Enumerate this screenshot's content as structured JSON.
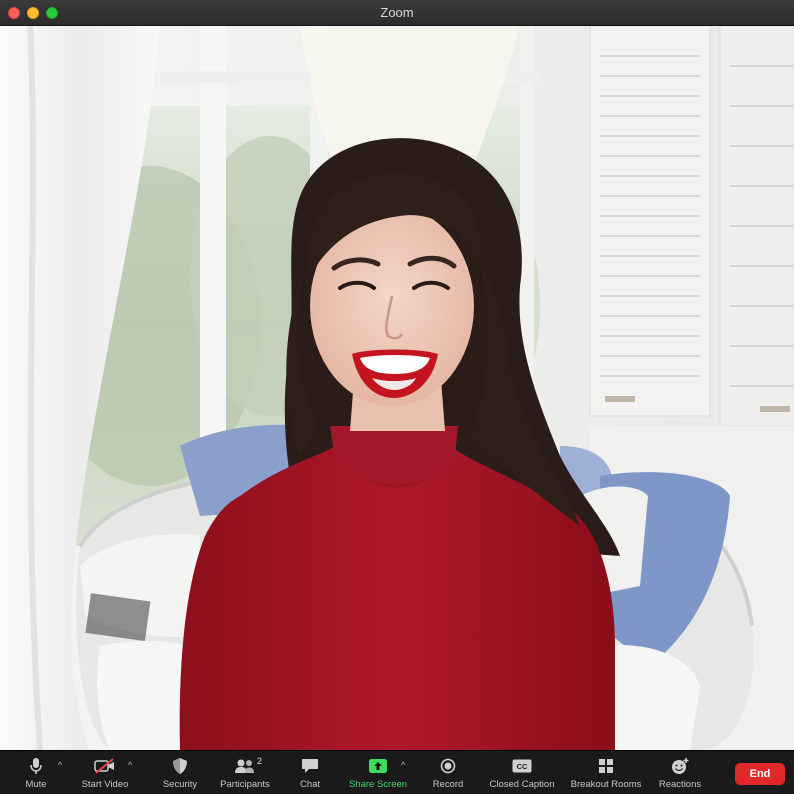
{
  "window": {
    "title": "Zoom"
  },
  "video": {
    "description_icon": "video-feed"
  },
  "toolbar": {
    "mute_label": "Mute",
    "start_video_label": "Start Video",
    "security_label": "Security",
    "participants_label": "Participants",
    "participants_count": "2",
    "chat_label": "Chat",
    "share_screen_label": "Share Screen",
    "record_label": "Record",
    "closed_caption_label": "Closed Caption",
    "closed_caption_icon_text": "CC",
    "breakout_rooms_label": "Breakout Rooms",
    "reactions_label": "Reactions",
    "end_label": "End"
  },
  "colors": {
    "end_button": "#e02828",
    "share_accent": "#3ddc5f",
    "toolbar_bg": "#1a1a1a"
  }
}
